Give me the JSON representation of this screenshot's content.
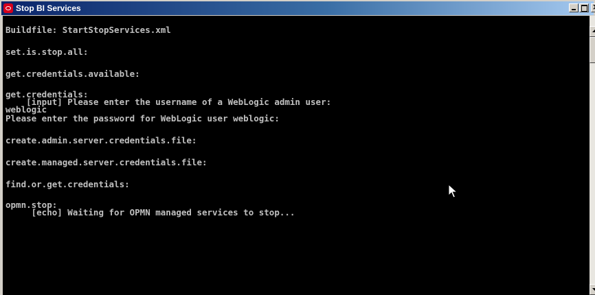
{
  "window": {
    "title": "Stop BI Services",
    "colors": {
      "titlebar": "#0a246a",
      "console_bg": "#000000",
      "console_text": "#c0c0c0"
    }
  },
  "console": {
    "lines": [
      "Buildfile: StartStopServices.xml",
      "",
      "set.is.stop.all:",
      "",
      "get.credentials.available:",
      "",
      "get.credentials:",
      "    [input] Please enter the username of a WebLogic admin user:",
      "weblogic",
      "Please enter the password for WebLogic user weblogic:",
      "",
      "create.admin.server.credentials.file:",
      "",
      "create.managed.server.credentials.file:",
      "",
      "find.or.get.credentials:",
      "",
      "opmn.stop:",
      "     [echo] Waiting for OPMN managed services to stop..."
    ]
  },
  "icons": {
    "app": "oracle-icon",
    "minimize": "minimize-icon",
    "maximize": "maximize-icon",
    "close": "close-icon",
    "cursor": "mouse-pointer-icon"
  }
}
